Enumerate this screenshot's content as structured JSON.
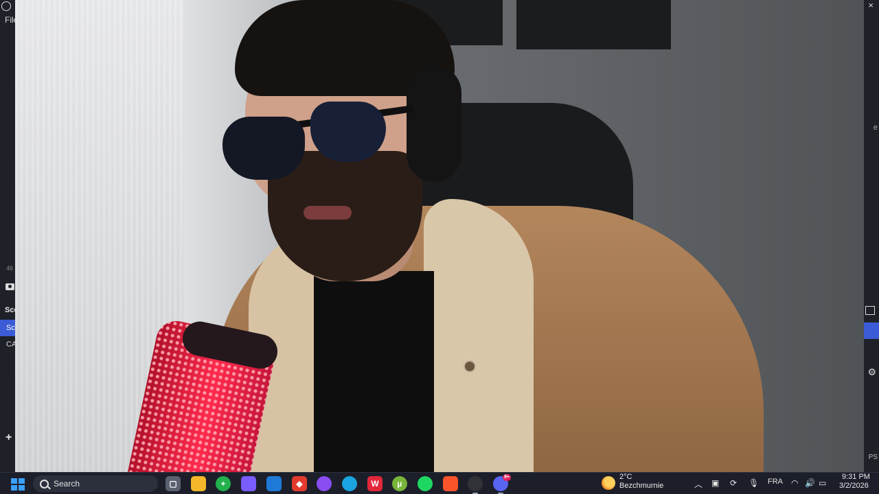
{
  "obs": {
    "menu_file": "File",
    "numbers_text": "46",
    "scenes_header": "Sce",
    "scene_active": "Sc",
    "scene_item": "CA",
    "add_symbol": "+",
    "close_symbol": "×",
    "right_edge_text": "e",
    "right_bottom_text": "PS"
  },
  "taskbar": {
    "search_placeholder": "Search",
    "apps": [
      {
        "name": "task-view",
        "glyph": "▢",
        "color": "#5b6170"
      },
      {
        "name": "file-explorer",
        "glyph": "",
        "color": "#f4b72a"
      },
      {
        "name": "green-plus-app",
        "glyph": "+",
        "color": "#22b14c"
      },
      {
        "name": "copilot",
        "glyph": "",
        "color": "#7a5cff"
      },
      {
        "name": "microsoft-store",
        "glyph": "",
        "color": "#1e7ad6"
      },
      {
        "name": "red-diamond-app",
        "glyph": "◆",
        "color": "#e23b2e"
      },
      {
        "name": "chat-app",
        "glyph": "",
        "color": "#8a4df0"
      },
      {
        "name": "edge-browser",
        "glyph": "",
        "color": "#1aa4e0"
      },
      {
        "name": "wps-office",
        "glyph": "W",
        "color": "#e3273b"
      },
      {
        "name": "utorrent",
        "glyph": "µ",
        "color": "#78b53a"
      },
      {
        "name": "spotify",
        "glyph": "",
        "color": "#1ed760"
      },
      {
        "name": "brave-browser",
        "glyph": "",
        "color": "#fb542b"
      },
      {
        "name": "obs-studio",
        "glyph": "",
        "color": "#303238"
      },
      {
        "name": "discord",
        "glyph": "",
        "color": "#5865f2",
        "badge": "9+"
      }
    ],
    "weather": {
      "temp": "2°C",
      "location": "Bezchmurnie"
    },
    "language": "FRA",
    "clock": {
      "time": "9:31 PM",
      "date": "3/2/2026"
    }
  }
}
